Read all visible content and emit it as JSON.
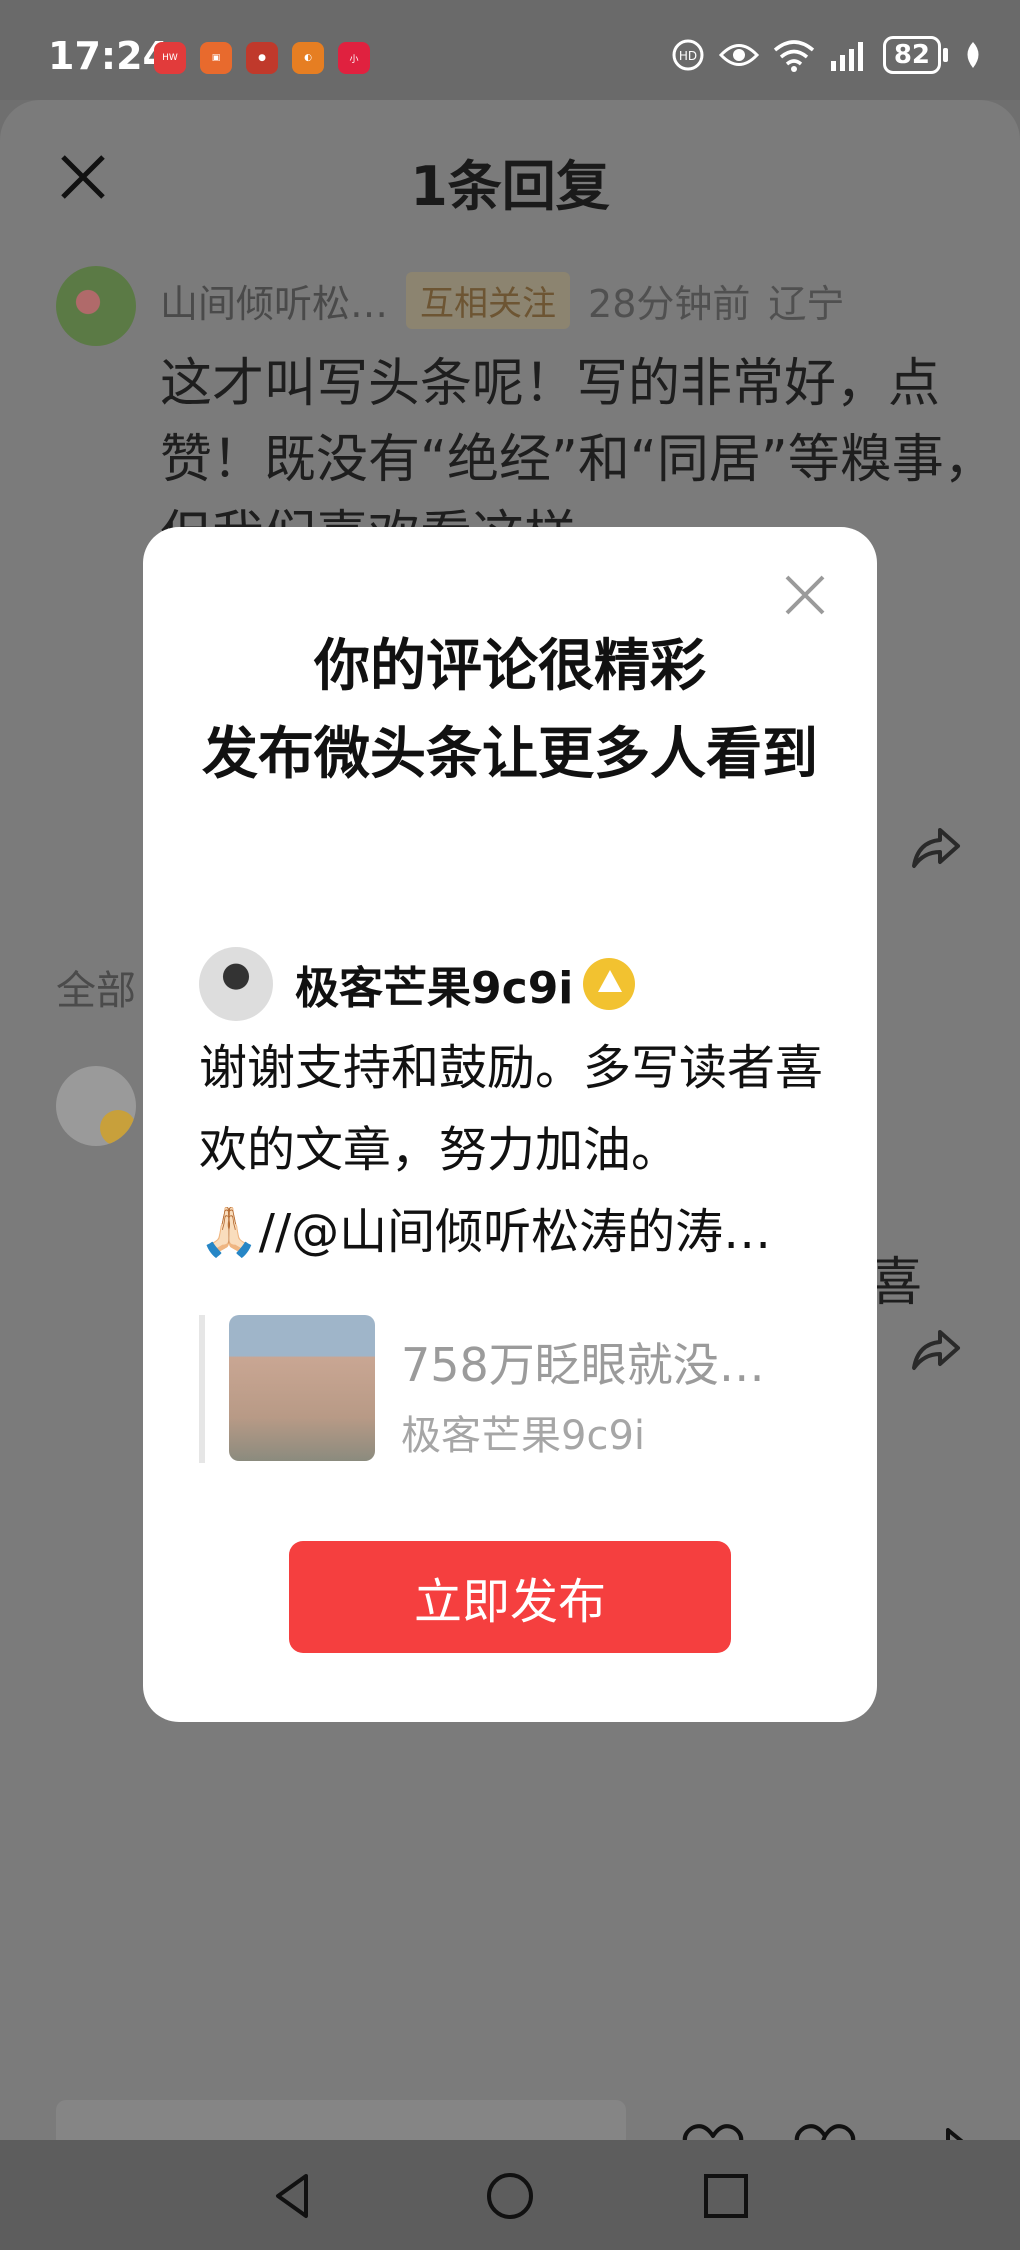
{
  "status_bar": {
    "time": "17:24",
    "battery": "82",
    "app_icons": [
      "huawei-app-icon",
      "app-icon",
      "app-icon",
      "app-icon",
      "xiaohongshu-icon"
    ]
  },
  "sheet": {
    "title": "1条回复"
  },
  "comment": {
    "username": "山间倾听松…",
    "badge": "互相关注",
    "time": "28分钟前",
    "location": "辽宁",
    "text": "这才叫写头条呢！写的非常好，点赞！既没有“绝经”和“同居”等糗事，但我们喜欢看这样"
  },
  "replies": {
    "section_label": "全部",
    "partial_text": "喜"
  },
  "modal": {
    "title": "你的评论很精彩\n发布微头条让更多人看到",
    "title_line1": "你的评论很精彩",
    "title_line2": "发布微头条让更多人看到",
    "username": "极客芒果9c9i",
    "text_line1": "谢谢支持和鼓励。多写读者喜欢的文章，努力加油。",
    "text_line2": "🙏🏻//@山间倾听松涛的涛…",
    "quote_title": "758万眨眼就没…",
    "quote_author": "极客芒果9c9i",
    "publish_label": "立即发布"
  },
  "colors": {
    "accent": "#f53f3f",
    "badge_gold": "#f2c230"
  }
}
